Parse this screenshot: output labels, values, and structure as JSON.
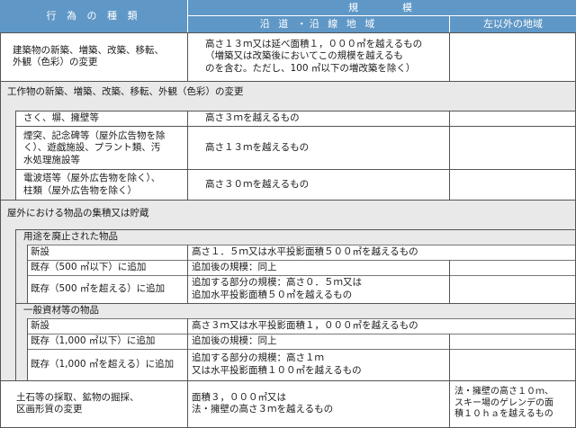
{
  "header": {
    "col1": "行 為 の 種 類",
    "scale": "規　　　模",
    "col2": "沿 道 ・沿 線 地 域",
    "col3": "左以外の地域"
  },
  "rows": {
    "buildings": {
      "label": "建築物の新築、増築、改築、移転、\n外観（色彩）の変更",
      "value": "高さ１３ｍ又は延べ面積１，０００㎡を越えるもの\n（増築又は改築後においてこの規模を越えるも\nのを含む。ただし、100 ㎡以下の増改築を除く）"
    },
    "structures": {
      "label": "工作物の新築、増築、改築、移転、外観（色彩）の変更",
      "fence_label": "さく、塀、擁壁等",
      "fence_value": "高さ３ｍを越えるもの",
      "chimney_label": "煙突、記念碑等（屋外広告物を除\nく）、遊戯施設、プラント類、汚\n水処理施設等",
      "chimney_value": "高さ１３ｍを越えるもの",
      "tower_label": "電波塔等（屋外広告物を除く）、\n柱類（屋外広告物を除く）",
      "tower_value": "高さ３０ｍを越えるもの"
    },
    "storage": {
      "label": "屋外における物品の集積又は貯蔵",
      "abandoned": {
        "title": "用途を廃止された物品",
        "new_label": "新設",
        "new_value": "高さ１．５ｍ又は水平投影面積５００㎡を越えるもの",
        "small_label": "既存（500 ㎡以下）に追加",
        "small_value": "追加後の規模：同上",
        "large_label": "既存（500 ㎡を超える）に追加",
        "large_value": "追加する部分の規模：高さ０．５ｍ又は\n追加水平投影面積５０㎡を越えるもの"
      },
      "general": {
        "title": "一般資材等の物品",
        "new_label": "新設",
        "new_value": "高さ３ｍ又は水平投影面積１，０００㎡を越えるもの",
        "small_label": "既存（1,000 ㎡以下）に追加",
        "small_value": "追加後の規模：同上",
        "large_label": "既存（1,000 ㎡を超える）に追加",
        "large_value": "追加する部分の規模：高さ１ｍ\n又は水平投影面積１００㎡を越えるもの"
      }
    },
    "earth": {
      "label": "土石等の採取、鉱物の掘採、\n区画形質の変更",
      "value": "面積３，０００㎡又は\n法・擁壁の高さ３ｍを越えるもの",
      "other_value": "法・擁壁の高さ１０ｍ、\nスキー場のゲレンデの面\n積１０ｈａを越えるもの"
    }
  }
}
